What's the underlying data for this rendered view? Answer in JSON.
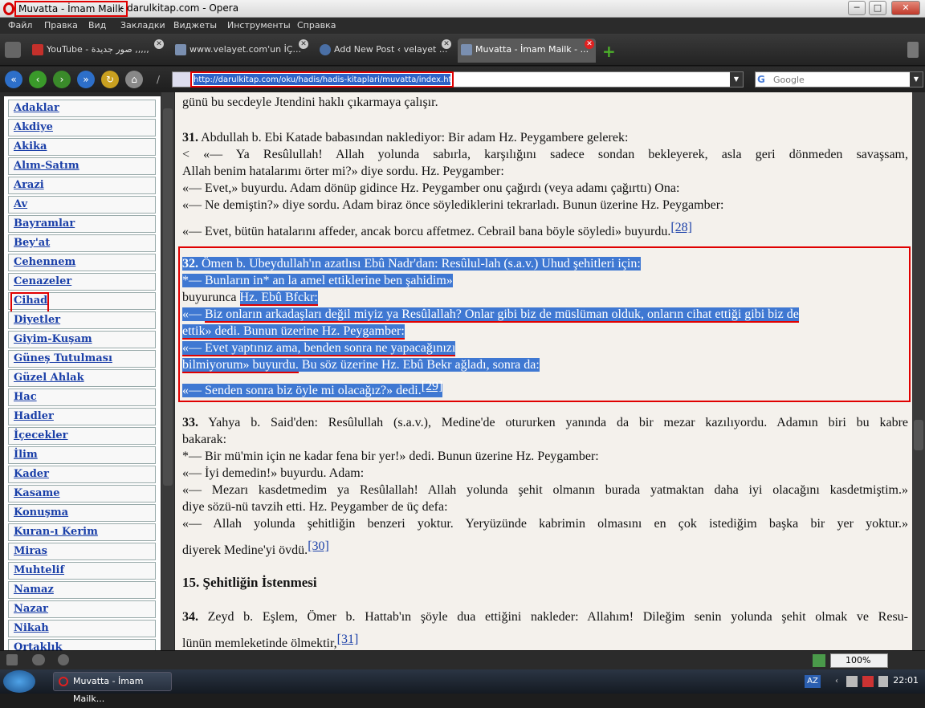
{
  "window": {
    "title_page": "Muvatta - İmam Mailk",
    "title_rest": "- darulkitap.com - Opera",
    "min": "─",
    "max": "□",
    "close": "✕"
  },
  "menu": [
    "Файл",
    "Правка",
    "Вид",
    "Закладки",
    "Виджеты",
    "Инструменты",
    "Справка"
  ],
  "tabs": [
    {
      "label": "YouTube - صور جديدة ,,,,,"
    },
    {
      "label": "www.velayet.com'un İÇ..."
    },
    {
      "label": "Add New Post ‹ velayet ..."
    },
    {
      "label": "Muvatta - İmam Mailk - ..."
    }
  ],
  "address": {
    "url": "http://darulkitap.com/oku/hadis/hadis-kitaplari/muvatta/index.htm",
    "search_placeholder": "Google"
  },
  "sidebar": {
    "items": [
      "Adaklar",
      "Akdiye",
      "Akika",
      "Alım-Satım",
      "Arazi",
      "Av",
      "Bayramlar",
      "Bey'at",
      "Cehennem",
      "Cenazeler",
      "Cihad",
      "Diyetler",
      "Giyim-Kuşam",
      "Güneş Tutulması",
      "Güzel Ahlak",
      "Hac",
      "Hadler",
      "İçecekler",
      "İlim",
      "Kader",
      "Kasame",
      "Konuşma",
      "Kuran-ı Kerim",
      "Miras",
      "Muhtelif",
      "Namaz",
      "Nazar",
      "Nikah",
      "Ortaklık"
    ]
  },
  "article": {
    "l0": "günü bu secdeyle Jtendini haklı çıkarmaya çalışır.",
    "p31_num": "31.",
    "p31_a": " Abdullah b. Ebi Katade babasından naklediyor: Bir adam Hz. Peygambere gelerek:",
    "p31_b": "<       «— Ya Resûlullah! Allah yolunda sabırla, karşılığını sadece sondan bekleyerek, asla geri dönmeden savaşsam,",
    "p31_c": "Allah benim hatalarımı örter mi?» diye sordu. Hz. Peygamber:",
    "p31_d": "«— Evet,» buyurdu. Adam dönüp gidince Hz. Peygamber onu çağırdı (veya adamı çağırttı) Ona:",
    "p31_e": "«— Ne demiştin?» diye sordu. Adam biraz önce söylediklerini tekrarladı. Bunun üzerine Hz. Peygamber:",
    "p31_f": "«— Evet, bütün hatalarını affeder, ancak borcu affetmez. Cebrail bana böyle söyledi» buyurdu.",
    "fn28": "[28]",
    "p32_num": "32.",
    "p32_a": " Ömen b. Ubeydullah'ın azatlısı Ebû Nadr'dan: Resûlul-lah (s.a.v.) Uhud şehitleri için:",
    "p32_b": "*— Bunların in* an la amel ettiklerine ben şahidim»",
    "p32_c1": "buyurunca ",
    "p32_c2": "Hz. Ebû Bfckr:",
    "p32_d1": "«— ",
    "p32_d2": "Biz onların arkadaşları değil miyiz ya Resûlallah? Onlar gibi biz de müslüman olduk, onların cihat ettiği gibi biz de",
    "p32_e": "ettik» dedi. Bunun üzerine Hz. Peygamber:",
    "p32_f": "«— Evet yaptınız ama, benden sonra ne yapacağınızı",
    "p32_g1": "bilmiyorum» buyurdu.",
    "p32_g2": " Bu söz üzerine Hz. Ebû Bekr ağladı, sonra da:",
    "p32_h": "«— Senden sonra biz öyle mi olacağız?» dedi.",
    "fn29": "[29]",
    "p33_num": "33.",
    "p33_a": " Yahya b. Said'den: Resûlullah (s.a.v.), Medine'de otururken yanında da bir mezar kazılıyordu. Adamın biri bu kabre",
    "p33_b": "bakarak:",
    "p33_c": "*— Bir mü'min için ne kadar fena bir yer!» dedi. Bunun üzerine Hz. Peygamber:",
    "p33_d": "«— İyi demedin!» buyurdu. Adam:",
    "p33_e": "«— Mezarı kasdetmedim ya Resûlallah! Allah yolunda şehit olmanın burada yatmaktan daha iyi olacağını kasdetmiştim.»",
    "p33_f": "diye sözü-nü tavzih etti. Hz. Peygamber de üç defa:",
    "p33_g": "«— Allah yolunda şehitliğin benzeri yoktur. Yeryüzünde kabrimin olmasını en çok istediğim başka bir yer yoktur.»",
    "p33_h": "diyerek Medine'yi övdü.",
    "fn30": "[30]",
    "h15": "15. Şehitliğin İstenmesi",
    "p34_num": "34.",
    "p34_a": " Zeyd b. Eşlem, Ömer b. Hattab'ın şöyle dua ettiğini nakleder: Allahım! Dileğim senin yolunda şehit olmak ve Resu-",
    "p34_b": "lünün memleketinde ölmektir,",
    "fn31": "[31]"
  },
  "status": {
    "zoom": "100%"
  },
  "taskbar": {
    "item": "Muvatta - İmam Mailk...",
    "lang": "AZ",
    "clock": "22:01"
  },
  "colors": {
    "selection": "#3f78d2",
    "annotation": "#e00000",
    "link": "#1a3fa8"
  }
}
